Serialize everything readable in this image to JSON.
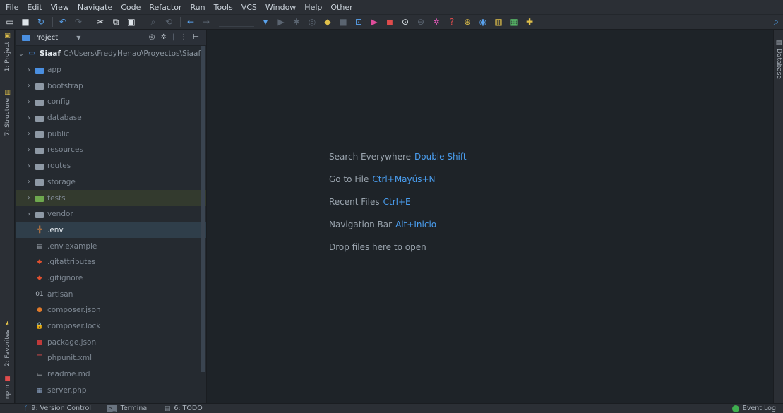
{
  "menu": [
    "File",
    "Edit",
    "View",
    "Navigate",
    "Code",
    "Refactor",
    "Run",
    "Tools",
    "VCS",
    "Window",
    "Help",
    "Other"
  ],
  "toolbar": {
    "icons": [
      {
        "name": "open-folder-icon",
        "glyph": "▭",
        "color": "#dfe5ea"
      },
      {
        "name": "save-all-icon",
        "glyph": "■",
        "color": "#dfe5ea"
      },
      {
        "name": "synchronize-icon",
        "glyph": "↻",
        "color": "#5aa3ee"
      },
      {
        "name": "undo-icon",
        "glyph": "↶",
        "color": "#5aa3ee"
      },
      {
        "name": "redo-icon",
        "glyph": "↷",
        "color": "#5a6470"
      },
      {
        "name": "cut-icon",
        "glyph": "✂",
        "color": "#dfe5ea"
      },
      {
        "name": "copy-icon",
        "glyph": "⧉",
        "color": "#dfe5ea"
      },
      {
        "name": "paste-icon",
        "glyph": "▣",
        "color": "#dfe5ea"
      },
      {
        "name": "find-icon",
        "glyph": "⌕",
        "color": "#5a6470"
      },
      {
        "name": "replace-icon",
        "glyph": "⟲",
        "color": "#5a6470"
      },
      {
        "name": "back-icon",
        "glyph": "←",
        "color": "#5aa3ee"
      },
      {
        "name": "forward-icon",
        "glyph": "→",
        "color": "#5a6470"
      }
    ],
    "run_icons": [
      {
        "name": "run-config-dropdown-icon",
        "glyph": "▾",
        "color": "#5aa3ee"
      },
      {
        "name": "run-icon",
        "glyph": "▶",
        "color": "#5a6470"
      },
      {
        "name": "debug-icon",
        "glyph": "✱",
        "color": "#5a6470"
      },
      {
        "name": "coverage-icon",
        "glyph": "◎",
        "color": "#5a6470"
      },
      {
        "name": "profile-icon",
        "glyph": "◆",
        "color": "#e0c04a"
      },
      {
        "name": "stop-icon",
        "glyph": "■",
        "color": "#5a6470"
      },
      {
        "name": "terminal-icon",
        "glyph": "⊡",
        "color": "#5aa3ee"
      },
      {
        "name": "play-icon",
        "glyph": "▶",
        "color": "#e04c9a"
      },
      {
        "name": "record-icon",
        "glyph": "◼",
        "color": "#e04c4c"
      },
      {
        "name": "history-icon",
        "glyph": "⊙",
        "color": "#dfe5ea"
      },
      {
        "name": "revert-icon",
        "glyph": "⊖",
        "color": "#5a6470"
      },
      {
        "name": "settings-icon",
        "glyph": "✲",
        "color": "#e05ab8"
      },
      {
        "name": "help-icon",
        "glyph": "?",
        "color": "#e04c4c"
      },
      {
        "name": "plugin-icon",
        "glyph": "⊕",
        "color": "#e0c04a"
      },
      {
        "name": "inspect-icon",
        "glyph": "◉",
        "color": "#5aa3ee"
      },
      {
        "name": "structure-icon",
        "glyph": "▥",
        "color": "#e0c04a"
      },
      {
        "name": "db-icon",
        "glyph": "▦",
        "color": "#5ac06a"
      },
      {
        "name": "extension-icon",
        "glyph": "✚",
        "color": "#e0c04a"
      }
    ]
  },
  "left_strip": {
    "project": "1: Project",
    "structure": "7: Structure",
    "favorites": "2: Favorites",
    "npm": "npm"
  },
  "right_strip": {
    "database": "Database"
  },
  "project_panel": {
    "title": "Project",
    "root": {
      "name": "Siaaf",
      "path": "C:\\Users\\FredyHenao\\Proyectos\\Siaaf"
    },
    "items": [
      {
        "label": "app",
        "type": "folder",
        "icon_color": "blue"
      },
      {
        "label": "bootstrap",
        "type": "folder"
      },
      {
        "label": "config",
        "type": "folder"
      },
      {
        "label": "database",
        "type": "folder"
      },
      {
        "label": "public",
        "type": "folder"
      },
      {
        "label": "resources",
        "type": "folder"
      },
      {
        "label": "routes",
        "type": "folder"
      },
      {
        "label": "storage",
        "type": "folder"
      },
      {
        "label": "tests",
        "type": "folder",
        "icon_color": "green"
      },
      {
        "label": "vendor",
        "type": "folder"
      },
      {
        "label": ".env",
        "type": "file",
        "icon_glyph": "╬",
        "icon_color": "#d08040"
      },
      {
        "label": ".env.example",
        "type": "file",
        "icon_glyph": "▤",
        "icon_color": "#aab2bb"
      },
      {
        "label": ".gitattributes",
        "type": "file",
        "icon_glyph": "◆",
        "icon_color": "#e0502f"
      },
      {
        "label": ".gitignore",
        "type": "file",
        "icon_glyph": "◆",
        "icon_color": "#e0502f"
      },
      {
        "label": "artisan",
        "type": "file",
        "icon_glyph": "01",
        "icon_color": "#aab2bb"
      },
      {
        "label": "composer.json",
        "type": "file",
        "icon_glyph": "●",
        "icon_color": "#e07a2a"
      },
      {
        "label": "composer.lock",
        "type": "file",
        "icon_glyph": "🔒",
        "icon_color": "#e04c4c"
      },
      {
        "label": "package.json",
        "type": "file",
        "icon_glyph": "■",
        "icon_color": "#c03a3a"
      },
      {
        "label": "phpunit.xml",
        "type": "file",
        "icon_glyph": "☰",
        "icon_color": "#e04c4c"
      },
      {
        "label": "readme.md",
        "type": "file",
        "icon_glyph": "▭",
        "icon_color": "#dfe5ea"
      },
      {
        "label": "server.php",
        "type": "file",
        "icon_glyph": "▦",
        "icon_color": "#8aa0c0"
      }
    ]
  },
  "editor_hints": [
    {
      "text": "Search Everywhere",
      "key": "Double Shift"
    },
    {
      "text": "Go to File",
      "key": "Ctrl+Mayús+N"
    },
    {
      "text": "Recent Files",
      "key": "Ctrl+E"
    },
    {
      "text": "Navigation Bar",
      "key": "Alt+Inicio"
    },
    {
      "text": "Drop files here to open",
      "key": ""
    }
  ],
  "status_bar": {
    "version_control": "9: Version Control",
    "terminal": "Terminal",
    "todo": "6: TODO",
    "event_log": "Event Log"
  },
  "colors": {
    "accent": "#4a9ef0",
    "background": "#1e2328",
    "panel": "#252a30"
  }
}
